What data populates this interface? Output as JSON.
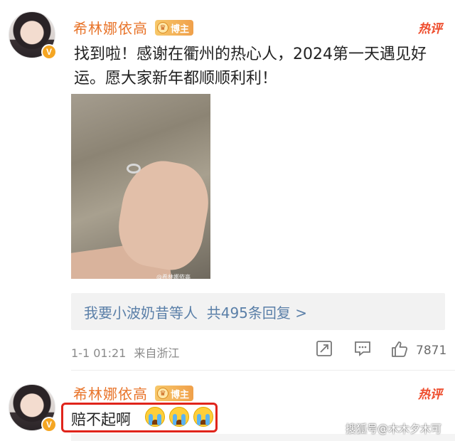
{
  "post": {
    "author": "希林娜依高",
    "badge_label": "博主",
    "hot_tag": "热评",
    "text": "找到啦！感谢在衢州的热心人，2024第一天遇见好运。愿大家新年都顺顺利利！",
    "photo_watermark": "@希林娜依高",
    "replies_link": "我要小波奶昔等人  共495条回复 >",
    "timestamp": "1-1 01:21",
    "location": "来自浙江",
    "like_count": "7871"
  },
  "comment": {
    "author": "希林娜依高",
    "badge_label": "博主",
    "hot_tag": "热评",
    "text": "赔不起啊"
  },
  "watermark": "搜狐号@木木夕木可",
  "colors": {
    "name": "#e8742a",
    "link": "#5a7fa8",
    "hot": "#ee4b2b",
    "highlight_box": "#e0241b"
  },
  "icons": [
    "verified-icon",
    "crown-badge-icon",
    "share-icon",
    "comment-icon",
    "like-icon",
    "crying-emoji-icon"
  ]
}
